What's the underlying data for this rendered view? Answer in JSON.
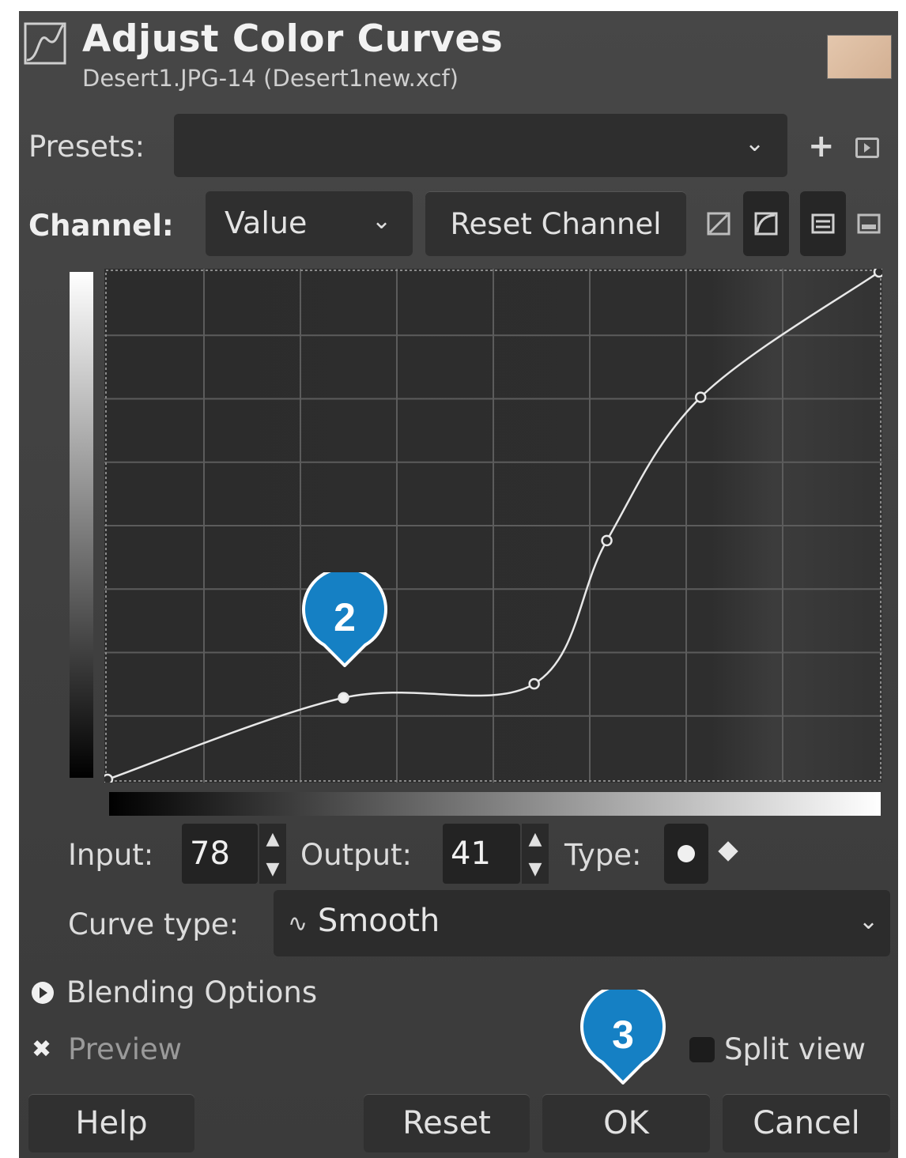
{
  "window": {
    "title": "Adjust Color Curves",
    "subtitle": "Desert1.JPG-14 (Desert1new.xcf)",
    "swatch_color": "#dcbca0"
  },
  "presets": {
    "label": "Presets:",
    "value": "",
    "add_icon": "plus-icon",
    "menu_icon": "preset-menu-icon"
  },
  "channel": {
    "label": "Channel:",
    "value": "Value",
    "reset_label": "Reset Channel",
    "toggles": [
      "linear-histogram",
      "log-histogram",
      "view-a",
      "view-b"
    ]
  },
  "curve": {
    "points": [
      [
        0,
        0
      ],
      [
        78,
        41
      ],
      [
        141,
        48
      ],
      [
        165,
        120
      ],
      [
        196,
        192
      ],
      [
        255,
        255
      ]
    ],
    "selected_point_index": 1
  },
  "point_editor": {
    "input_label": "Input:",
    "input_value": "78",
    "output_label": "Output:",
    "output_value": "41",
    "type_label": "Type:",
    "type_selected": "smooth"
  },
  "curve_type": {
    "label": "Curve type:",
    "value": "Smooth"
  },
  "blending": {
    "label": "Blending Options"
  },
  "preview": {
    "label": "Preview",
    "checked": true
  },
  "split_view": {
    "label": "Split view",
    "checked": false
  },
  "buttons": {
    "help": "Help",
    "reset": "Reset",
    "ok": "OK",
    "cancel": "Cancel"
  },
  "callouts": [
    {
      "number": "2",
      "color": "#1580c4"
    },
    {
      "number": "3",
      "color": "#1580c4"
    }
  ]
}
